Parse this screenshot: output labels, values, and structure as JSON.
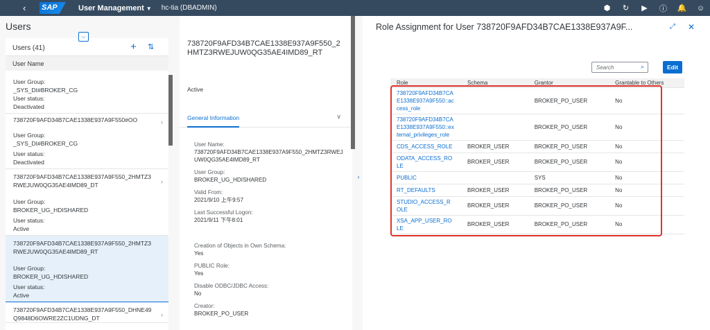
{
  "shell": {
    "logo": "SAP",
    "app_title": "User Management",
    "system": "hc-tia (DBADMIN)",
    "icons": [
      "settings-cube-icon",
      "refresh-icon",
      "play-icon",
      "help-icon",
      "bell-icon",
      "user-icon"
    ]
  },
  "master": {
    "title": "Users",
    "count_label": "Users (41)",
    "column_header": "User Name",
    "items": [
      {
        "name": "",
        "group_label": "User Group:",
        "group": "_SYS_DI#BROKER_CG",
        "status_label": "User status:",
        "status": "Deactivated"
      },
      {
        "name": "738720F9AFD34B7CAE1338E937A9F550#OO",
        "group_label": "User Group:",
        "group": "_SYS_DI#BROKER_CG",
        "status_label": "User status:",
        "status": "Deactivated"
      },
      {
        "name": "738720F9AFD34B7CAE1338E937A9F550_2HMTZ3RWEJUW0QG35AE4IMD89_DT",
        "group_label": "User Group:",
        "group": "BROKER_UG_HDISHARED",
        "status_label": "User status:",
        "status": "Active"
      },
      {
        "name": "738720F9AFD34B7CAE1338E937A9F550_2HMTZ3RWEJUW0QG35AE4IMD89_RT",
        "group_label": "User Group:",
        "group": "BROKER_UG_HDISHARED",
        "status_label": "User status:",
        "status": "Active"
      },
      {
        "name": "738720F9AFD34B7CAE1338E937A9F550_DHNE49Q9848D6OWRE2ZC1UDNG_DT"
      }
    ]
  },
  "detail": {
    "title": "738720F9AFD34B7CAE1338E937A9F550_2HMTZ3RWEJUW0QG35AE4IMD89_RT",
    "status": "Active",
    "tab": "General Information",
    "fields": [
      {
        "label": "User Name:",
        "value": "738720F9AFD34B7CAE1338E937A9F550_2HMTZ3RWEJUW0QG35AE4IMD89_RT"
      },
      {
        "label": "User Group:",
        "value": "BROKER_UG_HDISHARED"
      },
      {
        "label": "Valid From:",
        "value": "2021/9/10 上午9:57"
      },
      {
        "label": "Last Successful Logon:",
        "value": "2021/9/11 下午8:01"
      },
      {
        "label": "Creation of Objects in Own Schema:",
        "value": "Yes"
      },
      {
        "label": "PUBLIC Role:",
        "value": "Yes"
      },
      {
        "label": "Disable ODBC/JDBC Access:",
        "value": "No"
      },
      {
        "label": "Creator:",
        "value": "BROKER_PO_USER"
      }
    ]
  },
  "roles": {
    "title": "Role Assignment for User 738720F9AFD34B7CAE1338E937A9F...",
    "search_placeholder": "Search",
    "edit_label": "Edit",
    "columns": [
      "Role",
      "Schema",
      "Grantor",
      "Grantable to Others"
    ],
    "rows": [
      {
        "role": "738720F9AFD34B7CAE1338E937A9F550::access_role",
        "schema": "",
        "grantor": "BROKER_PO_USER",
        "grantable": "No"
      },
      {
        "role": "738720F9AFD34B7CAE1338E937A9F550::external_privileges_role",
        "schema": "",
        "grantor": "BROKER_PO_USER",
        "grantable": "No"
      },
      {
        "role": "CDS_ACCESS_ROLE",
        "schema": "BROKER_USER",
        "grantor": "BROKER_PO_USER",
        "grantable": "No"
      },
      {
        "role": "ODATA_ACCESS_ROLE",
        "schema": "BROKER_USER",
        "grantor": "BROKER_PO_USER",
        "grantable": "No"
      },
      {
        "role": "PUBLIC",
        "schema": "",
        "grantor": "SYS",
        "grantable": "No"
      },
      {
        "role": "RT_DEFAULTS",
        "schema": "BROKER_USER",
        "grantor": "BROKER_PO_USER",
        "grantable": "No"
      },
      {
        "role": "STUDIO_ACCESS_ROLE",
        "schema": "BROKER_USER",
        "grantor": "BROKER_PO_USER",
        "grantable": "No"
      },
      {
        "role": "XSA_APP_USER_ROLE",
        "schema": "BROKER_USER",
        "grantor": "BROKER_PO_USER",
        "grantable": "No"
      }
    ]
  },
  "colors": {
    "shell": "#354a5f",
    "accent": "#0a6ed1",
    "highlight_box": "#e0312c",
    "selected_row": "#e5f0fa"
  }
}
